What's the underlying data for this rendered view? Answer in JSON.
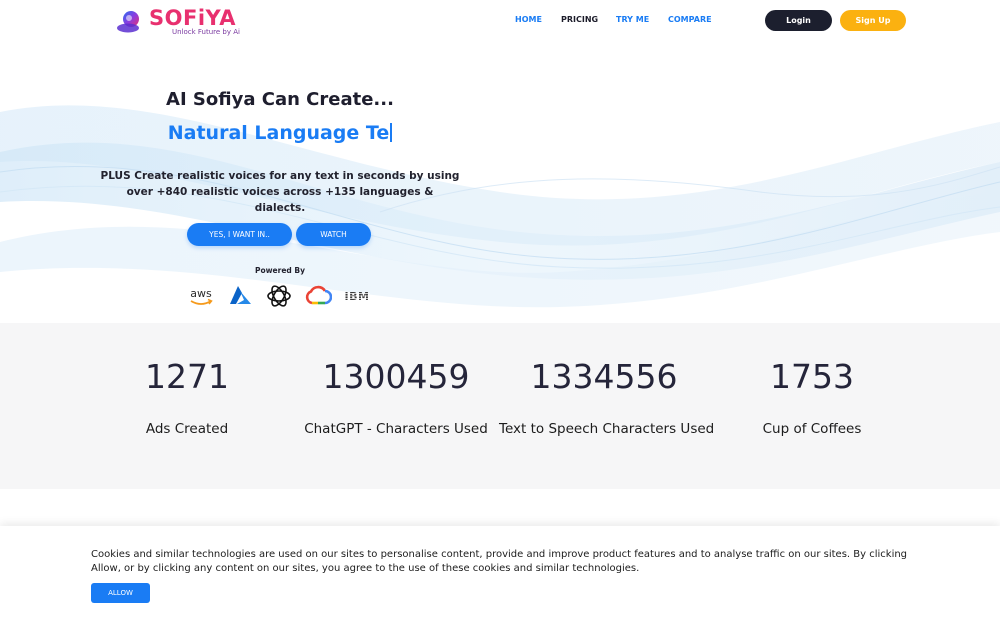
{
  "brand": {
    "name": "SOFiYA",
    "tagline": "Unlock Future by Ai",
    "accent_color": "#1a7cf4",
    "brand_pink": "#e8306f",
    "signup_color": "#fbb110"
  },
  "nav": {
    "items": [
      {
        "label": "HOME"
      },
      {
        "label": "PRICING"
      },
      {
        "label": "TRY ME"
      },
      {
        "label": "COMPARE"
      }
    ],
    "login_label": "Login",
    "signup_label": "Sign Up"
  },
  "hero": {
    "title": "AI Sofiya Can Create...",
    "typed_text": "Natural Language Te",
    "description": "PLUS Create realistic voices for any text in seconds by using over +840 realistic voices across +135 languages & dialects.",
    "cta_primary": "YES, I WANT IN..",
    "cta_secondary": "WATCH",
    "powered_by": "Powered By",
    "partners": [
      {
        "name": "aws",
        "icon": "aws-icon"
      },
      {
        "name": "Azure",
        "icon": "azure-icon"
      },
      {
        "name": "OpenAI",
        "icon": "openai-icon"
      },
      {
        "name": "Google Cloud",
        "icon": "google-cloud-icon"
      },
      {
        "name": "IBM",
        "icon": "ibm-icon"
      }
    ]
  },
  "stats": [
    {
      "value": "1271",
      "label": "Ads Created"
    },
    {
      "value": "1300459",
      "label": "ChatGPT - Characters Used"
    },
    {
      "value": "1334556",
      "label": "Text to Speech Characters Used"
    },
    {
      "value": "1753",
      "label": "Cup of Coffees"
    }
  ],
  "cookie": {
    "text": "Cookies and similar technologies are used on our sites to personalise content, provide and improve product features and to analyse traffic on our sites. By clicking Allow, or by clicking any content on our sites, you agree to the use of these cookies and similar technologies.",
    "allow_label": "ALLOW"
  }
}
